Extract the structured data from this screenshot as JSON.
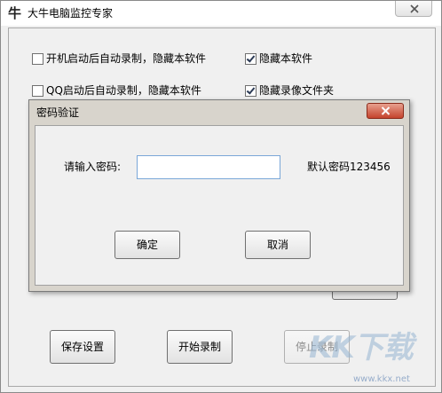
{
  "window": {
    "title": "大牛电脑监控专家",
    "icon_glyph": "牛"
  },
  "options": {
    "autostart_record_hide": {
      "label": "开机启动后自动录制，隐藏本软件",
      "checked": false
    },
    "hide_software": {
      "label": "隐藏本软件",
      "checked": true
    },
    "qq_autostart_record_hide": {
      "label": "QQ启动后自动录制，隐藏本软件",
      "checked": false
    },
    "hide_video_folder": {
      "label": "隐藏录像文件夹",
      "checked": true
    }
  },
  "buttons": {
    "save_settings": "保存设置",
    "start_recording": "开始录制",
    "stop_recording": "停止录制"
  },
  "dialog": {
    "title": "密码验证",
    "password_label": "请输入密码:",
    "password_value": "",
    "default_password_hint": "默认密码123456",
    "ok": "确定",
    "cancel": "取消"
  },
  "watermark": {
    "brand": "KK下载",
    "url": "www.kkx.net"
  },
  "colors": {
    "dialog_frame": "#d8d4cc",
    "close_red": "#c4432d",
    "input_border": "#7aa7d8"
  }
}
